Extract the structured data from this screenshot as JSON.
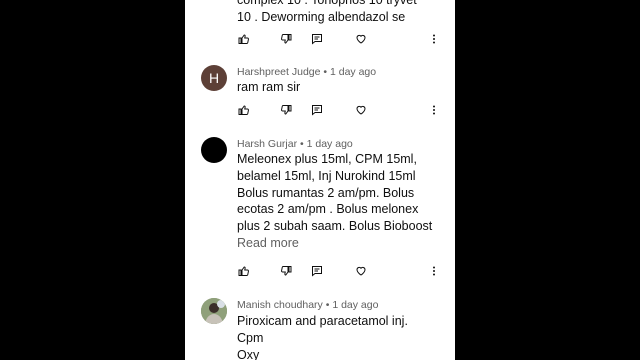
{
  "comments": [
    {
      "author": "",
      "time": "",
      "text_lines": [
        "complex 10 . Tonophos 10 tryvet",
        "10 . Deworming albendazol se"
      ],
      "read_more": ""
    },
    {
      "author": "Harshpreet Judge",
      "time": "1 day ago",
      "avatar_letter": "H",
      "avatar_color": "#5d4037",
      "text_lines": [
        "ram ram sir"
      ],
      "read_more": ""
    },
    {
      "author": "Harsh Gurjar",
      "time": "1 day ago",
      "avatar_letter": "",
      "avatar_color": "#000000",
      "text_lines": [
        "Meleonex plus 15ml, CPM 15ml,",
        "belamel 15ml, Inj Nurokind 15ml",
        "Bolus rumantas 2 am/pm. Bolus",
        "ecotas 2 am/pm . Bolus melonex",
        "plus 2 subah saam. Bolus Bioboost"
      ],
      "read_more": "Read more"
    },
    {
      "author": "Manish choudhary",
      "time": "1 day ago",
      "avatar_letter": "",
      "avatar_color": "#6d7a5a",
      "text_lines": [
        "Piroxicam and paracetamol inj.",
        "Cpm",
        "Oxy"
      ],
      "read_more": ""
    }
  ],
  "separator": " • ",
  "icons": [
    "thumbs-up-icon",
    "thumbs-down-icon",
    "reply-icon",
    "heart-icon",
    "more-vert-icon"
  ],
  "colors": {
    "page_bg": "#000000",
    "panel_bg": "#ffffff",
    "meta_text": "#606060",
    "body_text": "#0f0f0f"
  }
}
